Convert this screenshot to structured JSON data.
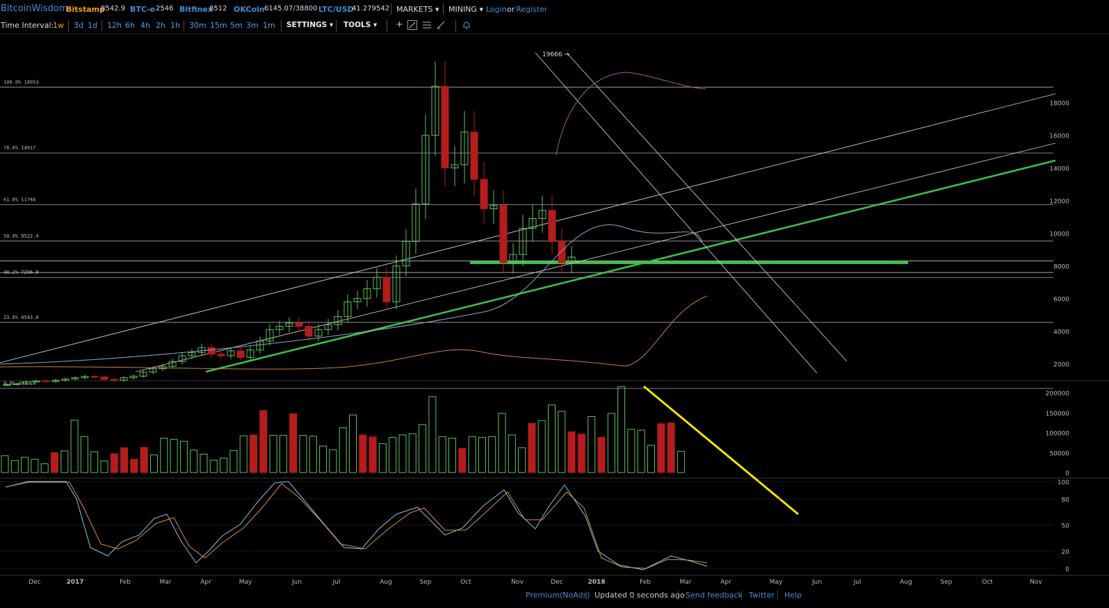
{
  "header": {
    "brand": "BitcoinWisdom",
    "tickers": [
      {
        "name": "Bitstamp",
        "value": "8542.9"
      },
      {
        "name": "BTC-e",
        "value": "2546"
      },
      {
        "name": "Bitfinex",
        "value": "8512"
      },
      {
        "name": "OKCoin",
        "value": "6145.07/38800"
      },
      {
        "name": "LTC/USD",
        "value": "41.279542"
      }
    ],
    "markets_label": "MARKETS ▾",
    "mining_label": "MINING ▾",
    "login_label": "Login",
    "or_label": "or",
    "register_label": "Register"
  },
  "toolbar": {
    "time_interval_label": "Time Interval:",
    "intervals": [
      "1w",
      "3d",
      "1d",
      "12h",
      "6h",
      "4h",
      "2h",
      "1h",
      "30m",
      "15m",
      "5m",
      "3m",
      "1m"
    ],
    "active_interval": "1w",
    "settings_label": "SETTINGS ▾",
    "tools_label": "TOOLS ▾",
    "tool_icons": [
      "crosshair-icon",
      "line-tool-icon",
      "horizontal-lines-icon",
      "pencil-icon",
      "alert-bell-icon"
    ]
  },
  "chart_data": [
    {
      "type": "candlestick",
      "title": "",
      "y_ticks": [
        2000,
        4000,
        6000,
        8000,
        10000,
        12000,
        14000,
        16000,
        18000
      ],
      "ylim": [
        0,
        20200
      ],
      "x_ticks": [
        "Dec",
        "2017",
        "Feb",
        "Mar",
        "Apr",
        "May",
        "Jun",
        "Jul",
        "Aug",
        "Sep",
        "Oct",
        "Nov",
        "Dec",
        "2018",
        "Feb",
        "Mar",
        "Apr",
        "May",
        "Jun",
        "Jul",
        "Aug",
        "Sep",
        "Oct",
        "Nov"
      ],
      "peak_label": "19666",
      "fib_levels": [
        {
          "label": "100.0% 18953",
          "value": 18953
        },
        {
          "label": "78.6% 14917",
          "value": 14917
        },
        {
          "label": "61.8% 11748",
          "value": 11748
        },
        {
          "label": "50.0% 9522.4",
          "value": 9522.4
        },
        {
          "label": "38.2% 7296.8",
          "value": 7296.8
        },
        {
          "label": "23.6% 4543.0",
          "value": 4543.0
        },
        {
          "label": "0.0% 497.14",
          "value": 497.14
        }
      ],
      "support_level": 8200,
      "closes": [
        740,
        780,
        900,
        960,
        920,
        1000,
        1080,
        1150,
        1230,
        1200,
        1050,
        1000,
        1150,
        1250,
        1500,
        1700,
        1850,
        2150,
        2500,
        2700,
        3000,
        2600,
        2500,
        2800,
        2400,
        2850,
        3400,
        4100,
        4300,
        4500,
        4300,
        3700,
        4100,
        4400,
        4900,
        5800,
        6000,
        6600,
        7300,
        5800,
        8000,
        9500,
        11800,
        16000,
        19000,
        14000,
        14200,
        16200,
        13300,
        11500,
        11700,
        8200,
        8700,
        10300,
        10900,
        11400,
        9500,
        8200,
        8540
      ],
      "volume_ticks": [
        0,
        50000,
        100000,
        150000,
        200000
      ],
      "volume": [
        42000,
        30000,
        38000,
        33000,
        22000,
        50000,
        54000,
        131000,
        90000,
        52000,
        29000,
        47000,
        62000,
        33000,
        63000,
        44000,
        86000,
        83000,
        78000,
        56000,
        46000,
        31000,
        36000,
        55000,
        92000,
        94000,
        155000,
        93000,
        93000,
        147000,
        93000,
        91000,
        66000,
        57000,
        112000,
        144000,
        94000,
        89000,
        72000,
        88000,
        94000,
        97000,
        120000,
        190000,
        90000,
        86000,
        60000,
        90000,
        88000,
        90000,
        148000,
        94000,
        62000,
        123000,
        130000,
        169000,
        153000,
        102000,
        96000,
        140000,
        88000,
        148000,
        215000,
        108000,
        106000,
        68000,
        122000,
        124000,
        53000
      ],
      "stoch_ticks": [
        0,
        20,
        50,
        80,
        100
      ]
    }
  ],
  "footer": {
    "premium_label": "Premium(NoAds)",
    "updated_label": "Updated 0 seconds ago",
    "feedback_label": "Send feedback",
    "twitter_label": "Twitter",
    "help_label": "Help"
  },
  "colors": {
    "up": "#5fc25f",
    "down": "#b51c1c",
    "support": "#36c24a",
    "trend_yellow": "#f5e600",
    "ma_pink": "#a858b0",
    "ma_blue": "#8fa8d0",
    "ma_orange": "#c9823c",
    "link": "#3f8fd6",
    "accent": "#e8a317"
  }
}
